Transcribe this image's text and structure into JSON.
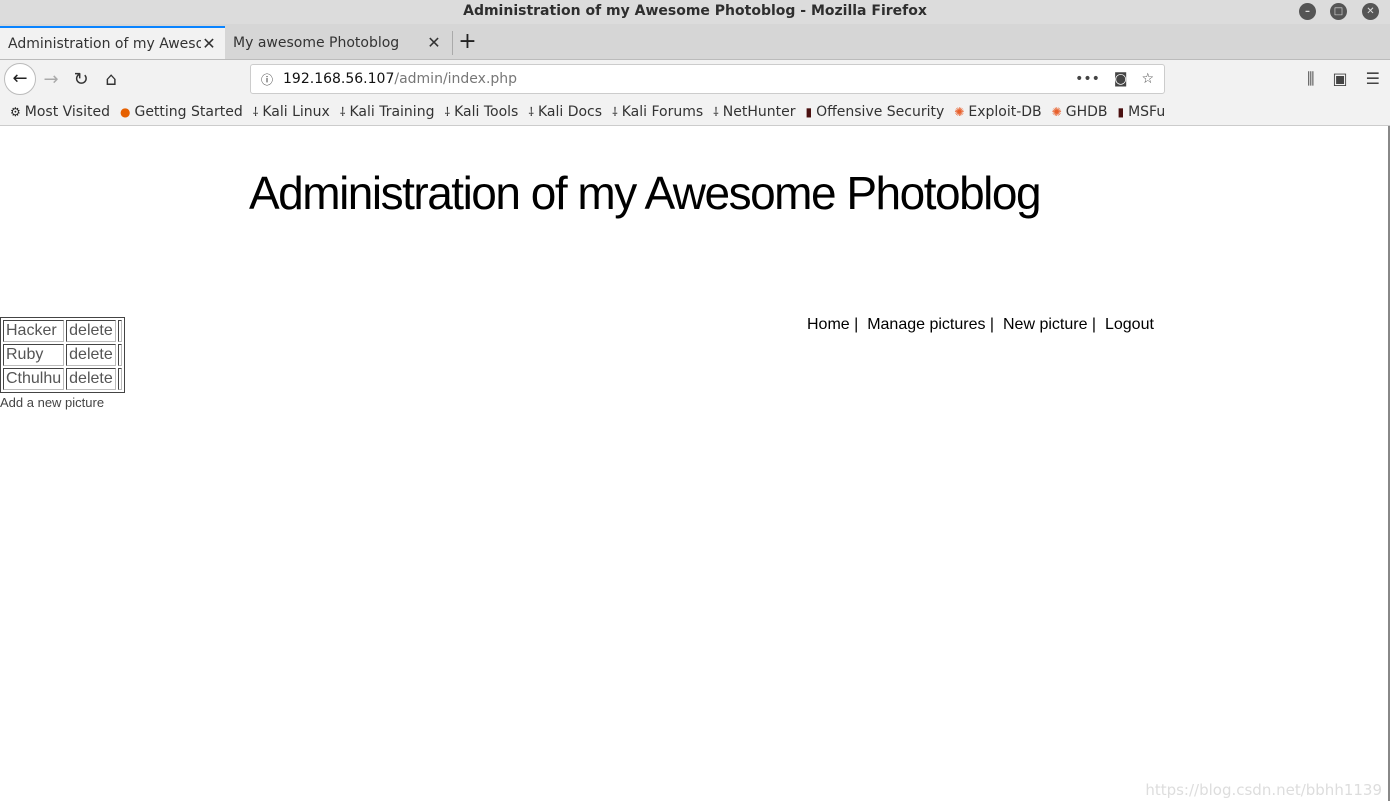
{
  "window": {
    "title": "Administration of my Awesome Photoblog - Mozilla Firefox"
  },
  "tabs": [
    {
      "label": "Administration of my Awesome Photoblog"
    },
    {
      "label": "My awesome Photoblog"
    }
  ],
  "url": {
    "host": "192.168.56.107",
    "path": "/admin/index.php"
  },
  "bookmarks": [
    {
      "label": "Most Visited",
      "icon": "gear-icon"
    },
    {
      "label": "Getting Started",
      "icon": "firefox-icon"
    },
    {
      "label": "Kali Linux",
      "icon": "kali-icon"
    },
    {
      "label": "Kali Training",
      "icon": "kali-icon"
    },
    {
      "label": "Kali Tools",
      "icon": "kali-icon"
    },
    {
      "label": "Kali Docs",
      "icon": "kali-icon"
    },
    {
      "label": "Kali Forums",
      "icon": "kali-icon"
    },
    {
      "label": "NetHunter",
      "icon": "kali-icon"
    },
    {
      "label": "Offensive Security",
      "icon": "offsec-icon"
    },
    {
      "label": "Exploit-DB",
      "icon": "exploitdb-icon"
    },
    {
      "label": "GHDB",
      "icon": "exploitdb-icon"
    },
    {
      "label": "MSFu",
      "icon": "offsec-icon"
    }
  ],
  "page": {
    "title": "Administration of my Awesome Photoblog",
    "menu": [
      "Home",
      "Manage pictures",
      "New picture",
      "Logout"
    ],
    "pictures": [
      {
        "name": "Hacker",
        "action": "delete"
      },
      {
        "name": "Ruby",
        "action": "delete"
      },
      {
        "name": "Cthulhu",
        "action": "delete"
      }
    ],
    "add_link": "Add a new picture"
  },
  "watermark": "https://blog.csdn.net/bbhh1139"
}
